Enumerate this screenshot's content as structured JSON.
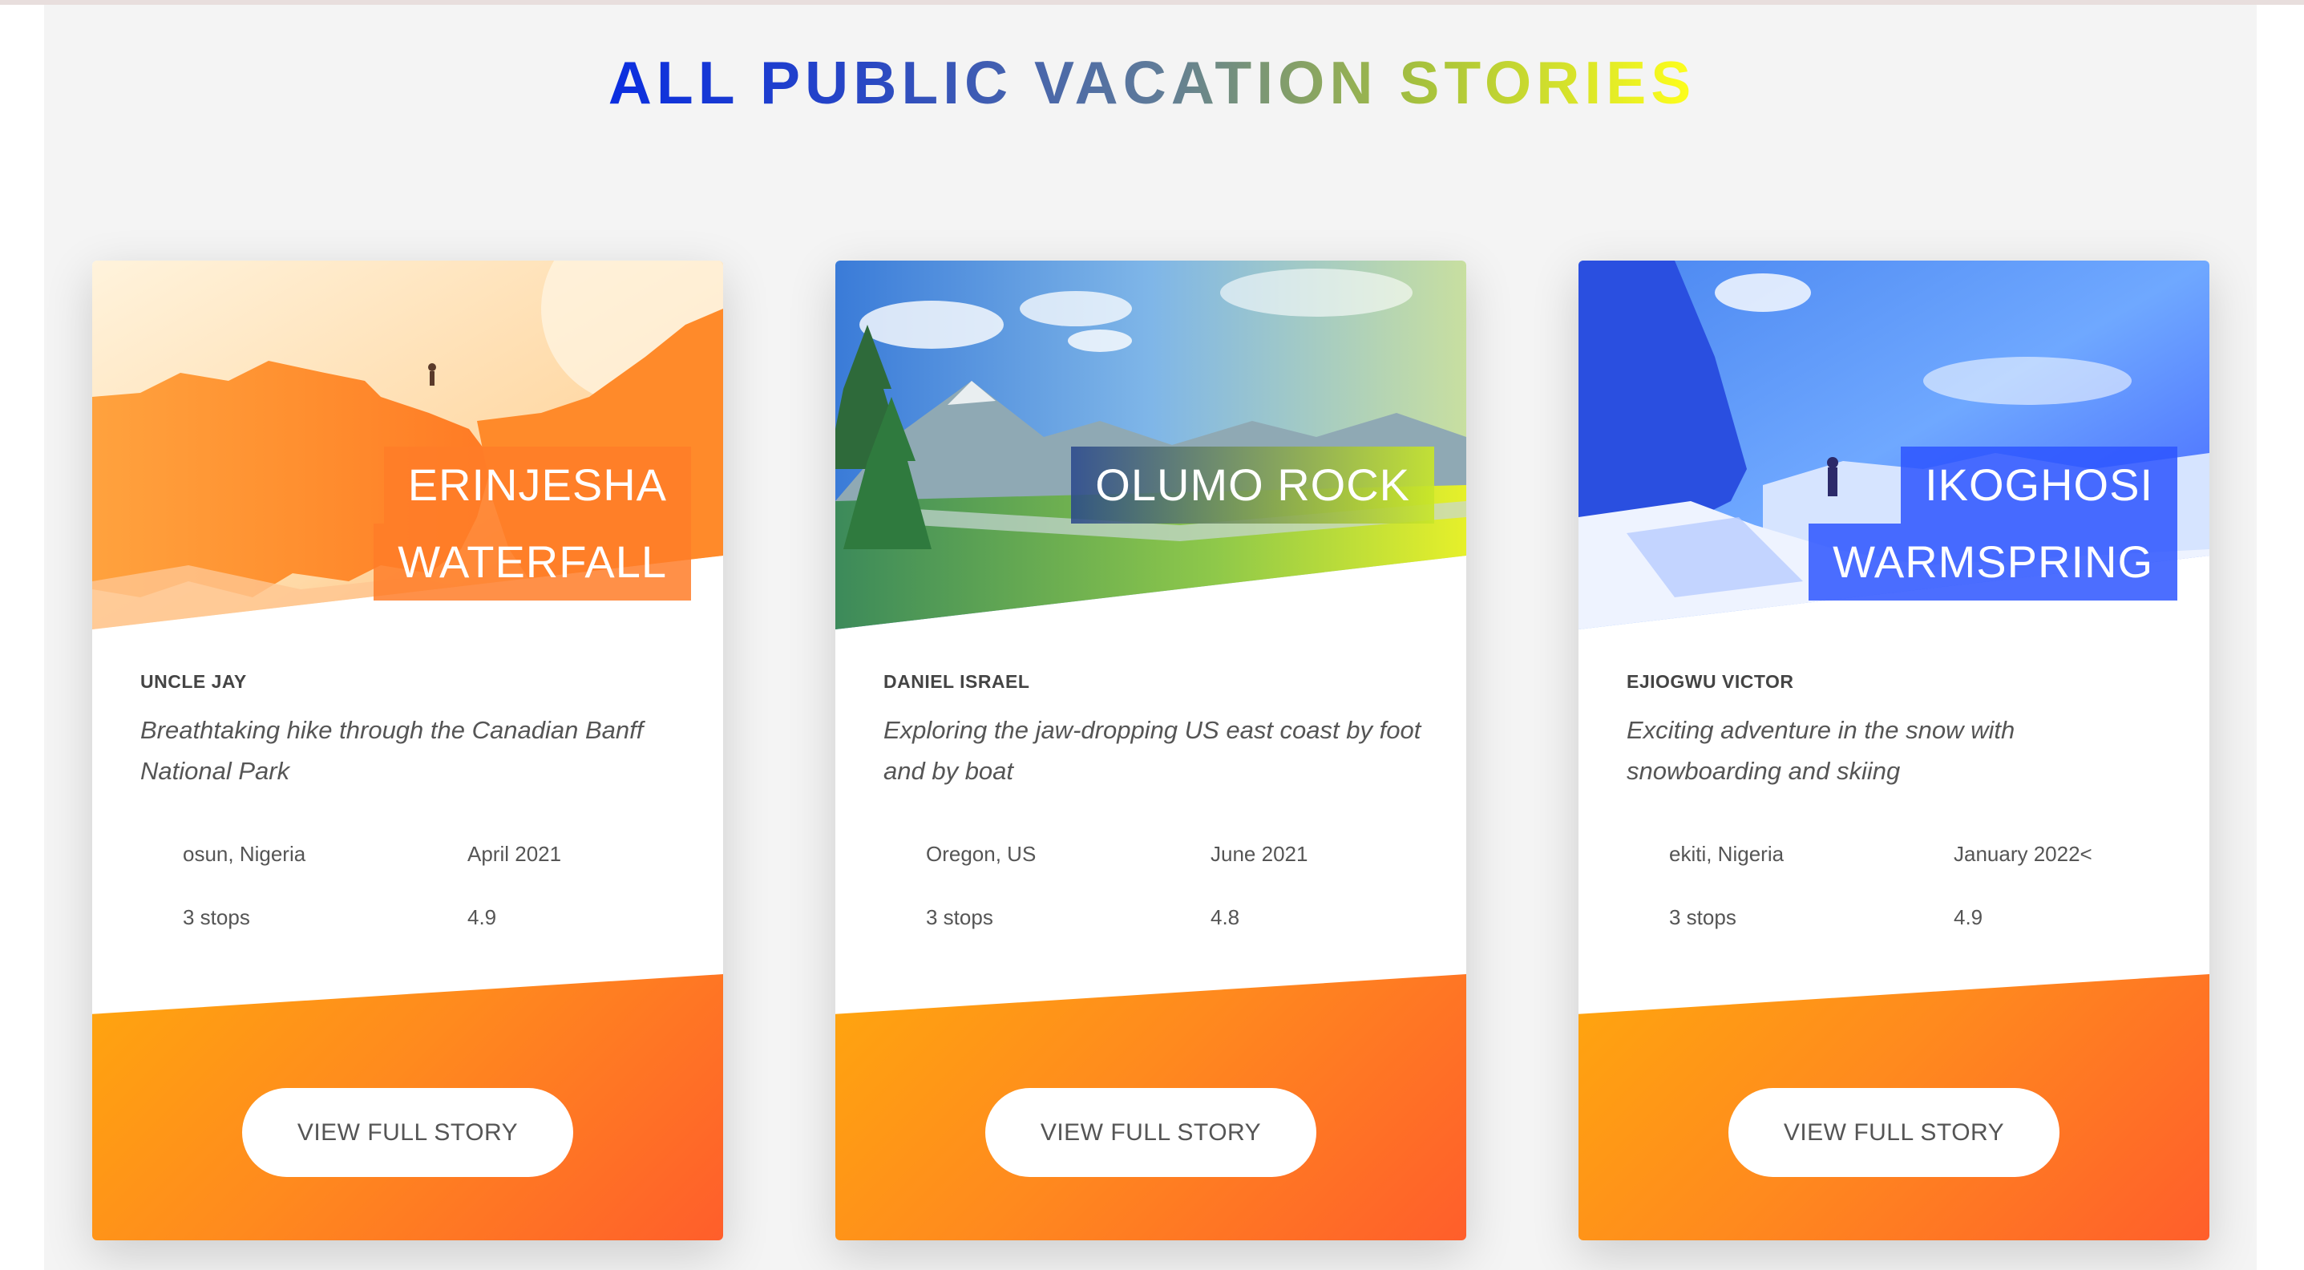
{
  "page": {
    "heading": "ALL PUBLIC VACATION STORIES"
  },
  "cards": [
    {
      "title_lines": [
        "ERINJESHA",
        "WATERFALL"
      ],
      "author": "UNCLE JAY",
      "description": "Breathtaking hike through the Canadian Banff National Park",
      "location": "osun, Nigeria",
      "date": "April 2021",
      "stops": "3 stops",
      "rating": "4.9",
      "button_label": "VIEW FULL STORY",
      "image_theme": "orange"
    },
    {
      "title_lines": [
        "OLUMO ROCK"
      ],
      "author": "DANIEL ISRAEL",
      "description": "Exploring the jaw-dropping US east coast by foot and by boat",
      "location": "Oregon, US",
      "date": "June 2021",
      "stops": "3 stops",
      "rating": "4.8",
      "button_label": "VIEW FULL STORY",
      "image_theme": "green"
    },
    {
      "title_lines": [
        "IKOGHOSI",
        "WARMSPRING"
      ],
      "author": "EJIOGWU VICTOR",
      "description": "Exciting adventure in the snow with snowboarding and skiing",
      "location": "ekiti, Nigeria",
      "date": "January 2022<",
      "stops": "3 stops",
      "rating": "4.9",
      "button_label": "VIEW FULL STORY",
      "image_theme": "blue"
    }
  ],
  "colors": {
    "accent_orange": "#ff8a1e",
    "accent_blue": "#2d55ff",
    "accent_yellow": "#ffff1c",
    "panel_bg": "#f4f4f4"
  }
}
